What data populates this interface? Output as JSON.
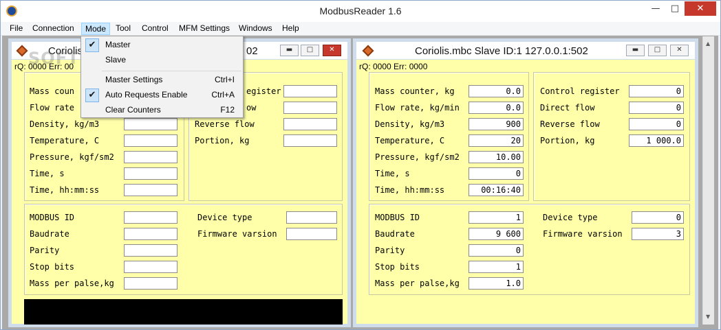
{
  "app": {
    "title": "ModbusReader 1.6"
  },
  "menubar": [
    "File",
    "Connection",
    "Mode",
    "Tool",
    "Control",
    "MFM Settings",
    "Windows",
    "Help"
  ],
  "mode_menu": {
    "items": [
      {
        "label": "Master",
        "shortcut": "",
        "checked": true
      },
      {
        "label": "Slave",
        "shortcut": "",
        "checked": false
      },
      {
        "label": "Master Settings",
        "shortcut": "Ctrl+I",
        "checked": false
      },
      {
        "label": "Auto Requests Enable",
        "shortcut": "Ctrl+A",
        "checked": true
      },
      {
        "label": "Clear Counters",
        "shortcut": "F12",
        "checked": false
      }
    ]
  },
  "watermark": "SOFTPEDIA",
  "left_window": {
    "title_visible": "Coriolis.",
    "title_tail": "02",
    "status": "rQ: 0000 Err: 00",
    "measurements": [
      {
        "label": "Mass coun",
        "value": ""
      },
      {
        "label": "Flow rate",
        "value": ""
      },
      {
        "label": "Density, kg/m3",
        "value": ""
      },
      {
        "label": "Temperature, C",
        "value": ""
      },
      {
        "label": "Pressure, kgf/sm2",
        "value": ""
      },
      {
        "label": "Time, s",
        "value": ""
      },
      {
        "label": "Time, hh:mm:ss",
        "value": ""
      }
    ],
    "control": [
      {
        "label": "egister",
        "value": ""
      },
      {
        "label": "ow",
        "value": ""
      },
      {
        "label": "Reverse flow",
        "value": ""
      },
      {
        "label": "Portion, kg",
        "value": ""
      }
    ],
    "device": [
      {
        "label": "MODBUS ID",
        "value": ""
      },
      {
        "label": "Baudrate",
        "value": ""
      },
      {
        "label": "Parity",
        "value": ""
      },
      {
        "label": "Stop bits",
        "value": ""
      },
      {
        "label": "Mass per palse,kg",
        "value": ""
      }
    ],
    "device_info": [
      {
        "label": "Device type",
        "value": ""
      },
      {
        "label": "Firmware varsion",
        "value": ""
      }
    ]
  },
  "right_window": {
    "title": "Coriolis.mbc Slave ID:1 127.0.0.1:502",
    "status": "rQ: 0000 Err: 0000",
    "measurements": [
      {
        "label": "Mass counter, kg",
        "value": "0.0"
      },
      {
        "label": "Flow rate, kg/min",
        "value": "0.0"
      },
      {
        "label": "Density, kg/m3",
        "value": "900"
      },
      {
        "label": "Temperature, C",
        "value": "20"
      },
      {
        "label": "Pressure, kgf/sm2",
        "value": "10.00"
      },
      {
        "label": "Time, s",
        "value": "0"
      },
      {
        "label": "Time, hh:mm:ss",
        "value": "00:16:40"
      }
    ],
    "control": [
      {
        "label": "Control register",
        "value": "0"
      },
      {
        "label": "Direct flow",
        "value": "0"
      },
      {
        "label": "Reverse flow",
        "value": "0"
      },
      {
        "label": "Portion, kg",
        "value": "1 000.0"
      }
    ],
    "device": [
      {
        "label": "MODBUS ID",
        "value": "1"
      },
      {
        "label": "Baudrate",
        "value": "9 600"
      },
      {
        "label": "Parity",
        "value": "0"
      },
      {
        "label": "Stop bits",
        "value": "1"
      },
      {
        "label": "Mass per palse,kg",
        "value": "1.0"
      }
    ],
    "device_info": [
      {
        "label": "Device type",
        "value": "0"
      },
      {
        "label": "Firmware varsion",
        "value": "3"
      }
    ]
  }
}
